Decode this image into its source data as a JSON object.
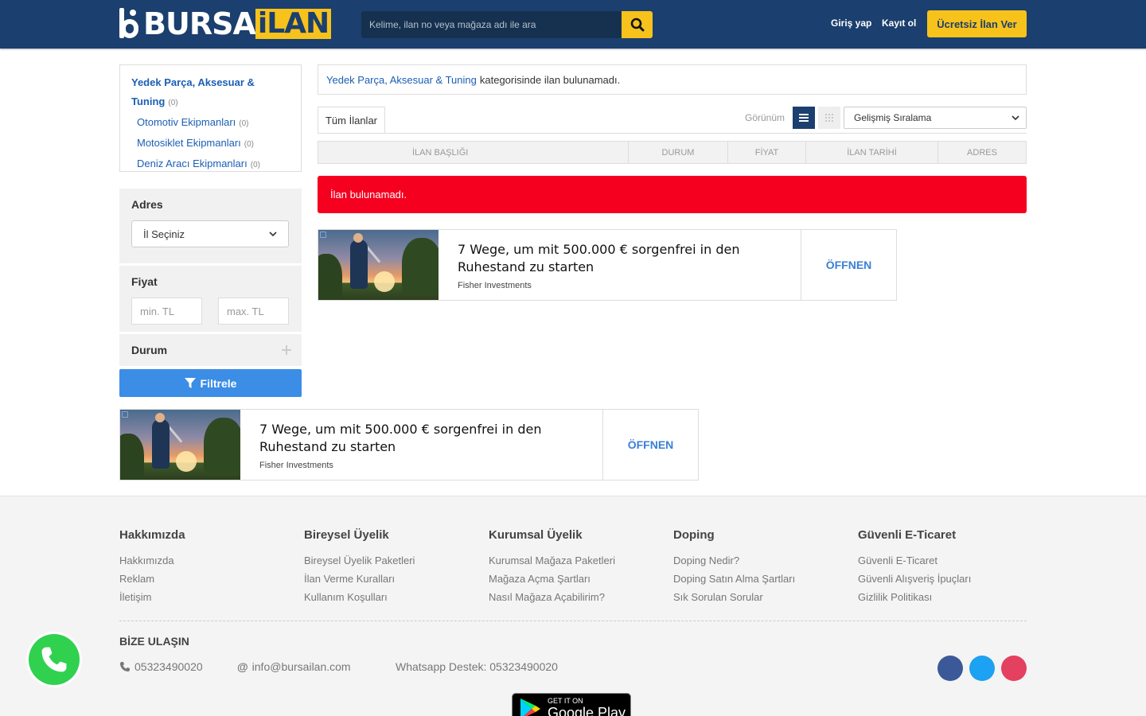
{
  "header": {
    "logo_part1": "BURSA",
    "logo_part2": "iLAN",
    "search_placeholder": "Kelime, ilan no veya mağaza adı ile ara",
    "login": "Giriş yap",
    "register": "Kayıt ol",
    "post_button": "Ücretsiz İlan Ver",
    "accent_color": "#f7c21b",
    "brand_color": "#1b3f6e"
  },
  "sidebar": {
    "category": {
      "label": "Yedek Parça, Aksesuar & Tuning",
      "count": "(0)"
    },
    "subcategories": [
      {
        "label": "Otomotiv Ekipmanları",
        "count": "(0)"
      },
      {
        "label": "Motosiklet Ekipmanları",
        "count": "(0)"
      },
      {
        "label": "Deniz Aracı Ekipmanları",
        "count": "(0)"
      }
    ],
    "address": {
      "title": "Adres",
      "select": "İl Seçiniz"
    },
    "price": {
      "title": "Fiyat",
      "min_placeholder": "min. TL",
      "max_placeholder": "max. TL"
    },
    "condition": {
      "title": "Durum"
    },
    "filter_button": "Filtrele"
  },
  "main": {
    "notice": {
      "category": "Yedek Parça, Aksesuar & Tuning",
      "text": "kategorisinde ilan bulunamadı."
    },
    "tab": "Tüm İlanlar",
    "view_label": "Görünüm",
    "sort": "Gelişmiş Sıralama",
    "columns": [
      "İLAN BAŞLIĞI",
      "DURUM",
      "FİYAT",
      "İLAN TARİHİ",
      "ADRES"
    ],
    "empty_alert": "İlan bulunamadı."
  },
  "ads": [
    {
      "title": "7 Wege, um mit 500.000 € sorgenfrei in den Ruhestand zu starten",
      "advertiser": "Fisher Investments",
      "cta": "ÖFFNEN"
    },
    {
      "title": "7 Wege, um mit 500.000 € sorgenfrei in den Ruhestand zu starten",
      "advertiser": "Fisher Investments",
      "cta": "ÖFFNEN"
    }
  ],
  "footer": {
    "columns": [
      {
        "title": "Hakkımızda",
        "links": [
          "Hakkımızda",
          "Reklam",
          "İletişim"
        ]
      },
      {
        "title": "Bireysel Üyelik",
        "links": [
          "Bireysel Üyelik Paketleri",
          "İlan Verme Kuralları",
          "Kullanım Koşulları"
        ]
      },
      {
        "title": "Kurumsal Üyelik",
        "links": [
          "Kurumsal Mağaza Paketleri",
          "Mağaza Açma Şartları",
          "Nasıl Mağaza Açabilirim?"
        ]
      },
      {
        "title": "Doping",
        "links": [
          "Doping Nedir?",
          "Doping Satın Alma Şartları",
          "Sık Sorulan Sorular"
        ]
      },
      {
        "title": "Güvenli E-Ticaret",
        "links": [
          "Güvenli E-Ticaret",
          "Güvenli Alışveriş İpuçları",
          "Gizlilik Politikası"
        ]
      }
    ],
    "contact_title": "BİZE ULAŞIN",
    "phone": "05323490020",
    "email": "info@bursailan.com",
    "whatsapp": "Whatsapp Destek: 05323490020",
    "social_colors": [
      "#3b5998",
      "#1da1f2",
      "#e4405f"
    ],
    "gplay_small": "GET IT ON",
    "gplay_big": "Google Play"
  }
}
